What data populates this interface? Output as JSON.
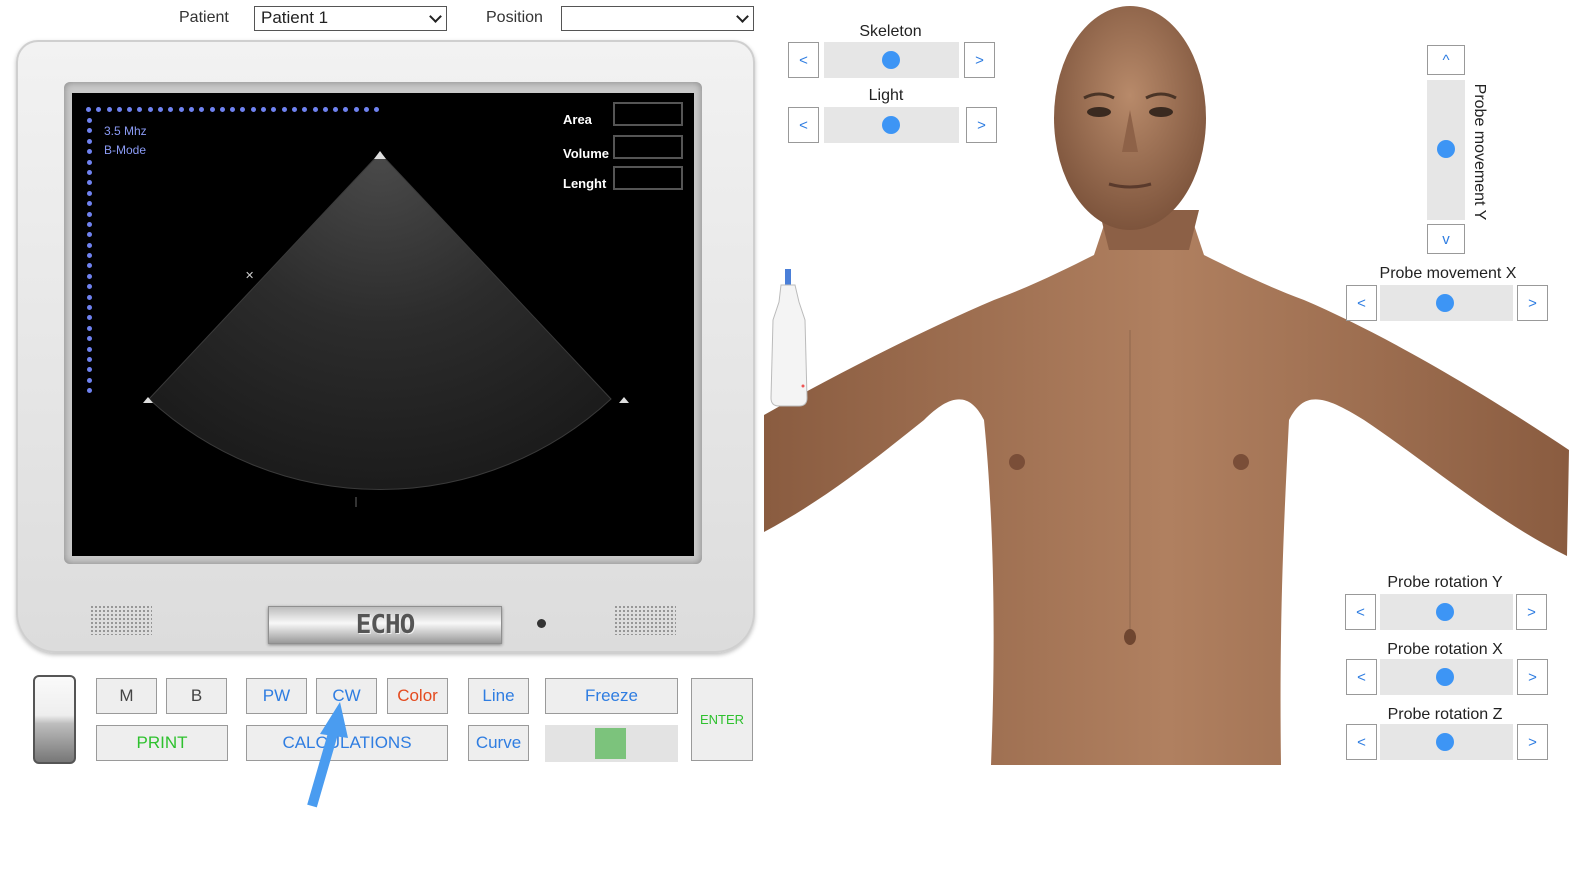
{
  "top": {
    "patient_label": "Patient",
    "patient_value": "Patient 1",
    "position_label": "Position",
    "position_value": ""
  },
  "screen": {
    "frequency": "3.5 Mhz",
    "mode": "B-Mode",
    "area_label": "Area",
    "volume_label": "Volume",
    "length_label": "Lenght"
  },
  "monitor": {
    "logo": "ECHO"
  },
  "controls": {
    "m": "M",
    "b": "B",
    "pw": "PW",
    "cw": "CW",
    "color": "Color",
    "line": "Line",
    "freeze": "Freeze",
    "print": "PRINT",
    "calculations": "CALCULATIONS",
    "curve": "Curve",
    "enter": "ENTER"
  },
  "sliders": {
    "skeleton": {
      "label": "Skeleton",
      "value": 0.5
    },
    "light": {
      "label": "Light",
      "value": 0.5
    },
    "probe_movement_y": {
      "label": "Probe movement Y",
      "value": 0.5,
      "up": "^",
      "down": "v"
    },
    "probe_movement_x": {
      "label": "Probe movement X",
      "value": 0.5
    },
    "probe_rotation_y": {
      "label": "Probe rotation Y",
      "value": 0.5
    },
    "probe_rotation_x": {
      "label": "Probe rotation X",
      "value": 0.5
    },
    "probe_rotation_z": {
      "label": "Probe rotation Z",
      "value": 0.5
    },
    "prev": "<",
    "next": ">"
  },
  "colors": {
    "accent_blue": "#3d95f5",
    "label_blue": "#2f7de1",
    "color_btn": "#e44b1f",
    "green": "#2ec12e",
    "indicator_green": "#7cc37c",
    "skin": "#a9785a"
  }
}
